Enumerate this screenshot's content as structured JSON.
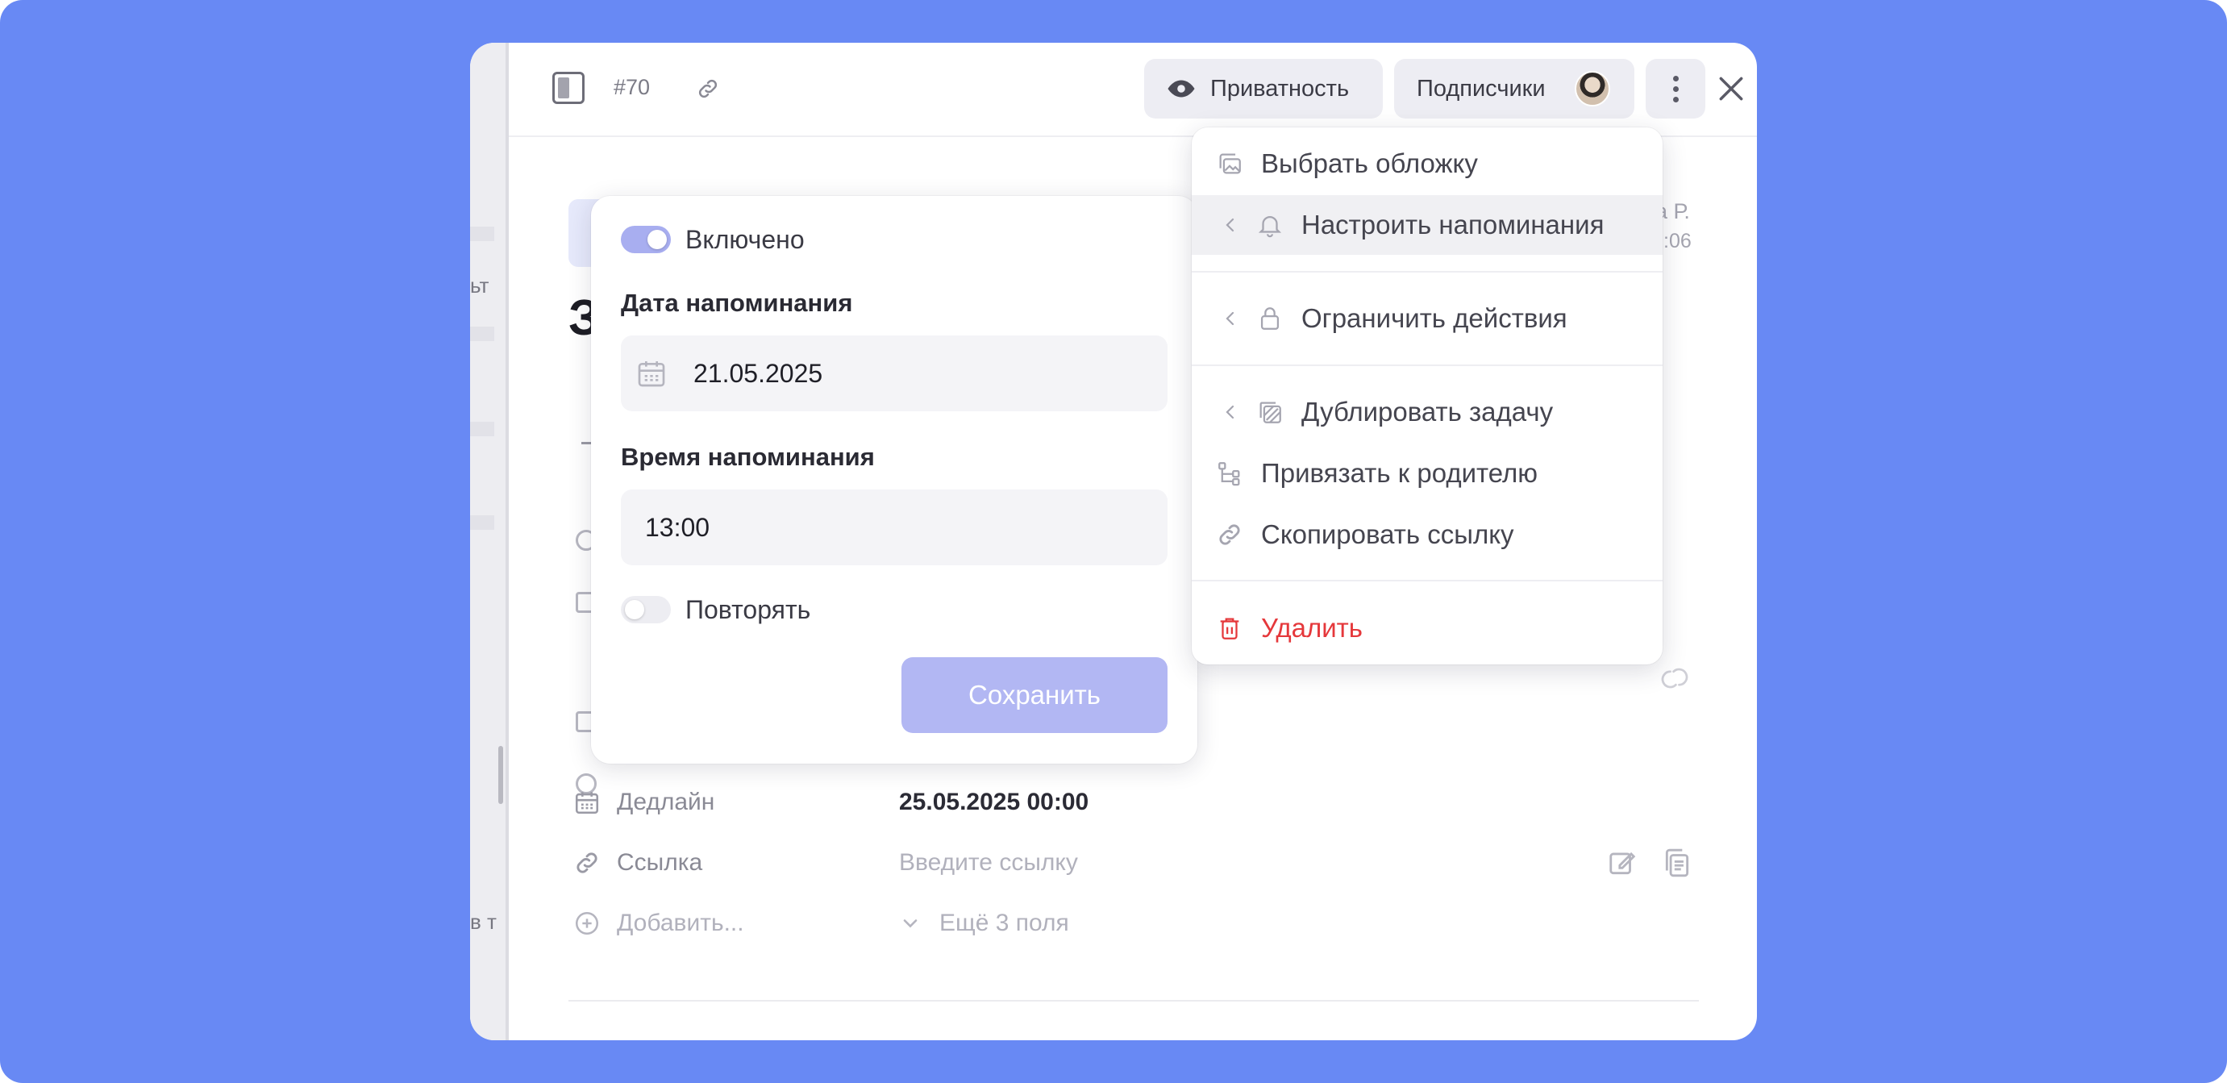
{
  "header": {
    "task_id": "#70",
    "privacy_label": "Приватность",
    "subscribers_label": "Подписчики"
  },
  "background": {
    "strip_text_1": "ьт",
    "strip_text_2": "в т",
    "title_fragment": "З",
    "meta_line_1": "а Р.",
    "meta_line_2": ":06",
    "fields": {
      "deadline_label": "Дедлайн",
      "deadline_value": "25.05.2025 00:00",
      "link_label": "Ссылка",
      "link_placeholder": "Введите ссылку",
      "add_label": "Добавить...",
      "more_fields_label": "Ещё 3 поля"
    }
  },
  "reminder": {
    "enabled_label": "Включено",
    "date_heading": "Дата напоминания",
    "date_value": "21.05.2025",
    "time_heading": "Время напоминания",
    "time_value": "13:00",
    "repeat_label": "Повторять",
    "save_label": "Сохранить",
    "enabled": true,
    "repeat": false
  },
  "menu": {
    "items": [
      {
        "label": "Выбрать обложку",
        "icon": "cover-icon"
      },
      {
        "label": "Настроить напоминания",
        "icon": "bell-icon"
      },
      {
        "label": "Ограничить действия",
        "icon": "lock-icon"
      },
      {
        "label": "Дублировать задачу",
        "icon": "duplicate-icon"
      },
      {
        "label": "Привязать к родителю",
        "icon": "hierarchy-icon"
      },
      {
        "label": "Скопировать ссылку",
        "icon": "link-icon"
      },
      {
        "label": "Удалить",
        "icon": "trash-icon"
      }
    ]
  },
  "colors": {
    "backdrop": "#6889F4",
    "accent_soft": "#B2B7F3",
    "danger": "#E5383B"
  }
}
